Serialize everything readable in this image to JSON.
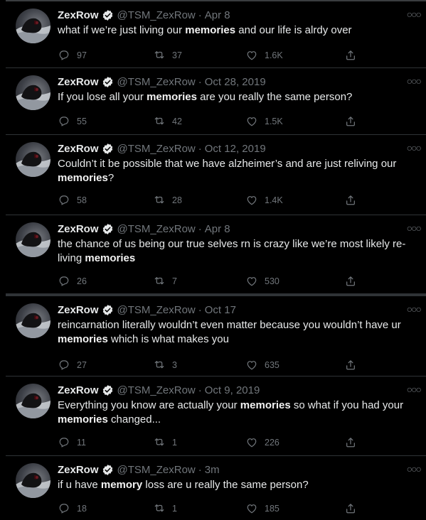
{
  "tweets": [
    {
      "name": "ZexRow",
      "handle": "@TSM_ZexRow",
      "time": "Apr 8",
      "text_html": "what if we’re just living our <b>memories</b> and our life is alrdy over",
      "replies": "97",
      "retweets": "37",
      "likes": "1.6K"
    },
    {
      "name": "ZexRow",
      "handle": "@TSM_ZexRow",
      "time": "Oct 28, 2019",
      "text_html": "If you lose all your <b>memories</b> are you really the same person?",
      "replies": "55",
      "retweets": "42",
      "likes": "1.5K"
    },
    {
      "name": "ZexRow",
      "handle": "@TSM_ZexRow",
      "time": "Oct 12, 2019",
      "text_html": "Couldn’t it be possible that we have alzheimer’s and are just reliving our <b>memories</b>?",
      "replies": "58",
      "retweets": "28",
      "likes": "1.4K"
    },
    {
      "name": "ZexRow",
      "handle": "@TSM_ZexRow",
      "time": "Apr 8",
      "text_html": "the chance of us being our true selves rn is crazy like we’re most likely re-living <b>memories</b>",
      "replies": "26",
      "retweets": "7",
      "likes": "530"
    },
    {
      "name": "ZexRow",
      "handle": "@TSM_ZexRow",
      "time": "Oct 17",
      "text_html": "reincarnation literally wouldn’t even matter because you wouldn’t have ur <b>memories</b> which is what makes you",
      "replies": "27",
      "retweets": "3",
      "likes": "635"
    },
    {
      "name": "ZexRow",
      "handle": "@TSM_ZexRow",
      "time": "Oct 9, 2019",
      "text_html": "Everything you know are actually your <b>memories</b> so what if you had your <b>memories</b> changed...",
      "replies": "11",
      "retweets": "1",
      "likes": "226"
    },
    {
      "name": "ZexRow",
      "handle": "@TSM_ZexRow",
      "time": "3m",
      "text_html": "if u have <b>memory</b> loss are u really the same person?",
      "replies": "18",
      "retweets": "1",
      "likes": "185"
    }
  ],
  "separator": "·",
  "icons": {
    "reply": "reply-icon",
    "retweet": "retweet-icon",
    "like": "heart-icon",
    "share": "share-icon",
    "more": "more-icon",
    "verified": "verified-badge-icon"
  },
  "colors": {
    "background": "#000000",
    "text": "#e7e9ea",
    "muted": "#71767b",
    "divider": "#2f3336"
  }
}
